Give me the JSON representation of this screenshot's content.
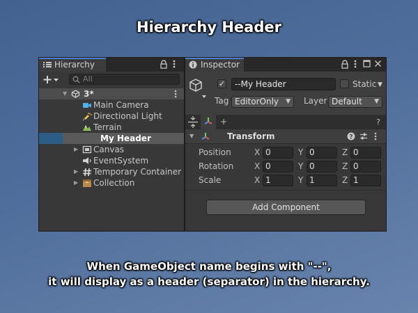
{
  "title": "Hierarchy Header",
  "caption": {
    "line1": "When GameObject name begins with \"--\",",
    "line2": "it will display as a header (separator) in the hierarchy."
  },
  "hierarchy": {
    "tab_label": "Hierarchy",
    "search_placeholder": "All",
    "scene": {
      "name": "3*"
    },
    "items": [
      {
        "label": "Main Camera",
        "icon": "camera-icon"
      },
      {
        "label": "Directional Light",
        "icon": "light-icon"
      },
      {
        "label": "Terrain",
        "icon": "terrain-icon"
      },
      {
        "label": "My Header",
        "icon": "none",
        "selected": true,
        "header": true
      },
      {
        "label": "Canvas",
        "icon": "canvas-icon",
        "expandable": true
      },
      {
        "label": "EventSystem",
        "icon": "event-system-icon"
      },
      {
        "label": "Temporary Container",
        "icon": "hash-icon",
        "expandable": true
      },
      {
        "label": "Collection",
        "icon": "box-icon",
        "expandable": true
      }
    ]
  },
  "inspector": {
    "tab_label": "Inspector",
    "object_name": "--My Header",
    "active": true,
    "static_label": "Static",
    "tag_label": "Tag",
    "tag_value": "EditorOnly",
    "layer_label": "Layer",
    "layer_value": "Default",
    "component_toolbar": {
      "plus": "+",
      "help": "?"
    },
    "transform": {
      "title": "Transform",
      "rows": [
        {
          "label": "Position",
          "x": "0",
          "y": "0",
          "z": "0"
        },
        {
          "label": "Rotation",
          "x": "0",
          "y": "0",
          "z": "0"
        },
        {
          "label": "Scale",
          "x": "1",
          "y": "1",
          "z": "1"
        }
      ],
      "axes": {
        "x": "X",
        "y": "Y",
        "z": "Z"
      }
    },
    "add_component_label": "Add Component"
  },
  "colors": {
    "selection": "#2c5d87",
    "header_row": "#5a5a5a",
    "tab_accent": "#4c7fd4"
  }
}
